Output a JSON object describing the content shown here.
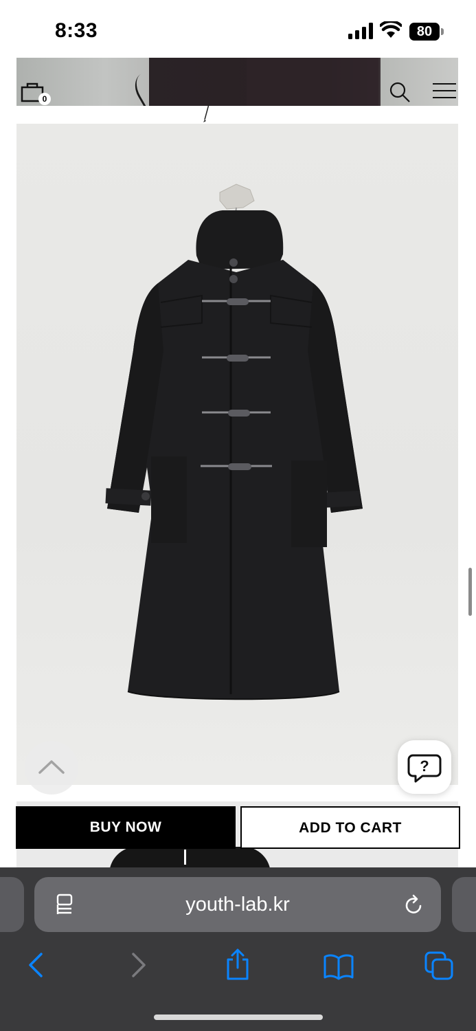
{
  "status_bar": {
    "time": "8:33",
    "battery_level": "80"
  },
  "header": {
    "cart_count": "0",
    "icons": [
      "bag-icon",
      "search-icon",
      "menu-icon"
    ]
  },
  "product": {
    "image_subject": "black hooded duffle coat on hanger"
  },
  "actions": {
    "buy_now_label": "BUY NOW",
    "add_to_cart_label": "ADD TO CART"
  },
  "browser": {
    "url": "youth-lab.kr",
    "toolbar_icons": [
      "back-icon",
      "forward-icon",
      "share-icon",
      "bookmarks-icon",
      "tabs-icon"
    ]
  },
  "colors": {
    "accent": "#0a84ff",
    "primary_button_bg": "#000000",
    "secondary_button_bg": "#ffffff",
    "browser_chrome": "#3a3a3c"
  }
}
